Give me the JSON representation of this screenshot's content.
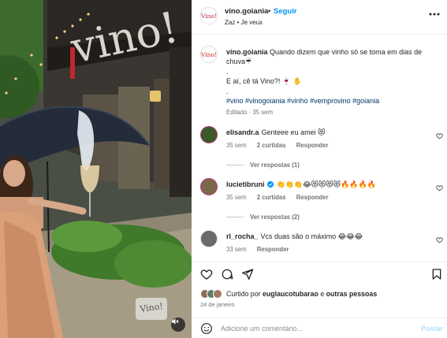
{
  "post": {
    "username": "vino.goiania",
    "follow_label": "Seguir",
    "separator": "•",
    "audio": "Zaz • Je veux",
    "logo_text": "Vino!"
  },
  "caption": {
    "username": "vino.goiania",
    "line1": "Quando dizem que vinho só se toma em dias de chuva☔",
    "line2": ".",
    "line3": "E aí, cê tá Vino?! 🍷 ✋",
    "line4": ".",
    "hashtags": "#vino #vinogoiania #vinho #vemprovino #goiania",
    "meta": "Editado · 35 sem"
  },
  "comments": [
    {
      "username": "elisandr.a",
      "text": "Genteee eu amei 😻",
      "time": "35 sem",
      "likes": "2 curtidas",
      "reply_label": "Responder",
      "view_replies": "Ver respostas (1)",
      "verified": false
    },
    {
      "username": "lucietibruni",
      "text": "👏👏👏😂😻😻😻😻🔥🔥🔥🔥",
      "time": "35 sem",
      "likes": "2 curtidas",
      "reply_label": "Responder",
      "view_replies": "Ver respostas (2)",
      "verified": true
    },
    {
      "username": "rl_rocha_",
      "text": "Vcs duas são o máximo 😂😂😂",
      "time": "33 sem",
      "likes": "",
      "reply_label": "Responder",
      "view_replies": "",
      "verified": false
    }
  ],
  "likes_bar": {
    "liked_prefix": "Curtido por",
    "liked_user": "euglaucotubarao",
    "liked_joiner": "e",
    "liked_others": "outras pessoas",
    "date": "24 de janeiro"
  },
  "comment_box": {
    "placeholder": "Adicione um comentário...",
    "post_label": "Postar"
  },
  "media": {
    "sign_text": "vino!",
    "glass_text": "Vino!"
  },
  "colors": {
    "brand": "#c0282d",
    "link": "#00376b",
    "follow": "#0095f6",
    "post_disabled": "#b2dffc",
    "muted": "#737373"
  }
}
